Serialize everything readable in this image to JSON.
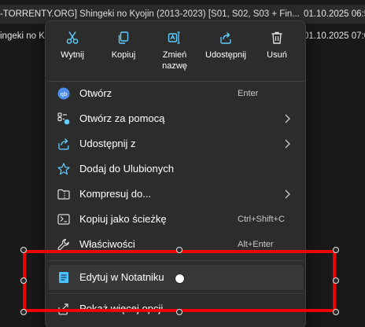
{
  "file_list": {
    "row1_name": "-TORRENTY.ORG] Shingeki no Kyojin (2013-2023) [S01, S02, S03 + Fin...",
    "row1_date": "01.10.2025 06:5",
    "row2_name": "ingeki no Ky",
    "row2_date": "01.10.2025 07:0"
  },
  "toolbar": {
    "cut": "Wytnij",
    "copy": "Kopiuj",
    "rename": "Zmień nazwę",
    "share": "Udostępnij",
    "delete": "Usuń"
  },
  "menu": {
    "open": "Otwórz",
    "open_shortcut": "Enter",
    "open_with": "Otwórz za pomocą",
    "share_with": "Udostępnij z",
    "add_favorites": "Dodaj do Ulubionych",
    "compress": "Kompresuj do...",
    "copy_path": "Kopiuj jako ścieżkę",
    "copy_path_shortcut": "Ctrl+Shift+C",
    "properties": "Właściwości",
    "properties_shortcut": "Alt+Enter",
    "edit_notepad": "Edytuj w Notatniku",
    "more_options": "Pokaż więcej opcji"
  },
  "colors": {
    "accent": "#60cdff",
    "annotation": "#ee0000",
    "menu_bg": "#2c2c2c"
  },
  "icons": [
    "scissors-icon",
    "copy-icon",
    "rename-icon",
    "share-icon",
    "trash-icon",
    "open-app-icon",
    "open-with-icon",
    "share-to-icon",
    "star-icon",
    "folder-zip-icon",
    "path-icon",
    "wrench-icon",
    "notepad-icon",
    "more-options-icon"
  ]
}
